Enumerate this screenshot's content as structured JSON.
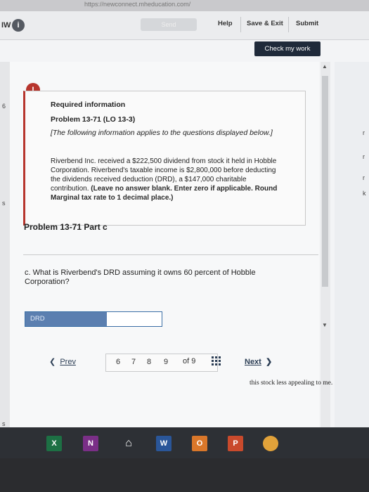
{
  "browser": {
    "url": "https://newconnect.mheducation.com/"
  },
  "header": {
    "brand": "IW",
    "send_label": "Send",
    "help_label": "Help",
    "save_exit_label": "Save & Exit",
    "submit_label": "Submit",
    "check_label": "Check my work"
  },
  "required": {
    "title": "Required information",
    "problem": "Problem 13-71 (LO 13-3)",
    "italic_note": "[The following information applies to the questions displayed below.]",
    "body_normal": "Riverbend Inc. received a $222,500 dividend from stock it held in Hobble Corporation. Riverbend's taxable income is $2,800,000 before deducting the dividends received deduction (DRD), a $147,000 charitable contribution.",
    "body_bold": "(Leave no answer blank. Enter zero if applicable. Round Marginal tax rate to 1 decimal place.)"
  },
  "part": {
    "title": "Problem 13-71 Part c",
    "question": "c. What is Riverbend's DRD assuming it owns 60 percent of Hobble Corporation?",
    "answer_label": "DRD",
    "answer_value": ""
  },
  "pager": {
    "prev_label": "Prev",
    "pages": [
      "6",
      "7",
      "8",
      "9"
    ],
    "of_label": "of 9",
    "next_label": "Next"
  },
  "left_strip": [
    "6",
    "s",
    "s"
  ],
  "right_strip": [
    "r",
    "r",
    "r",
    "k"
  ],
  "background_text": "this stock less appealing to me.",
  "taskbar": [
    "X",
    "N",
    "W",
    "O",
    "P"
  ]
}
